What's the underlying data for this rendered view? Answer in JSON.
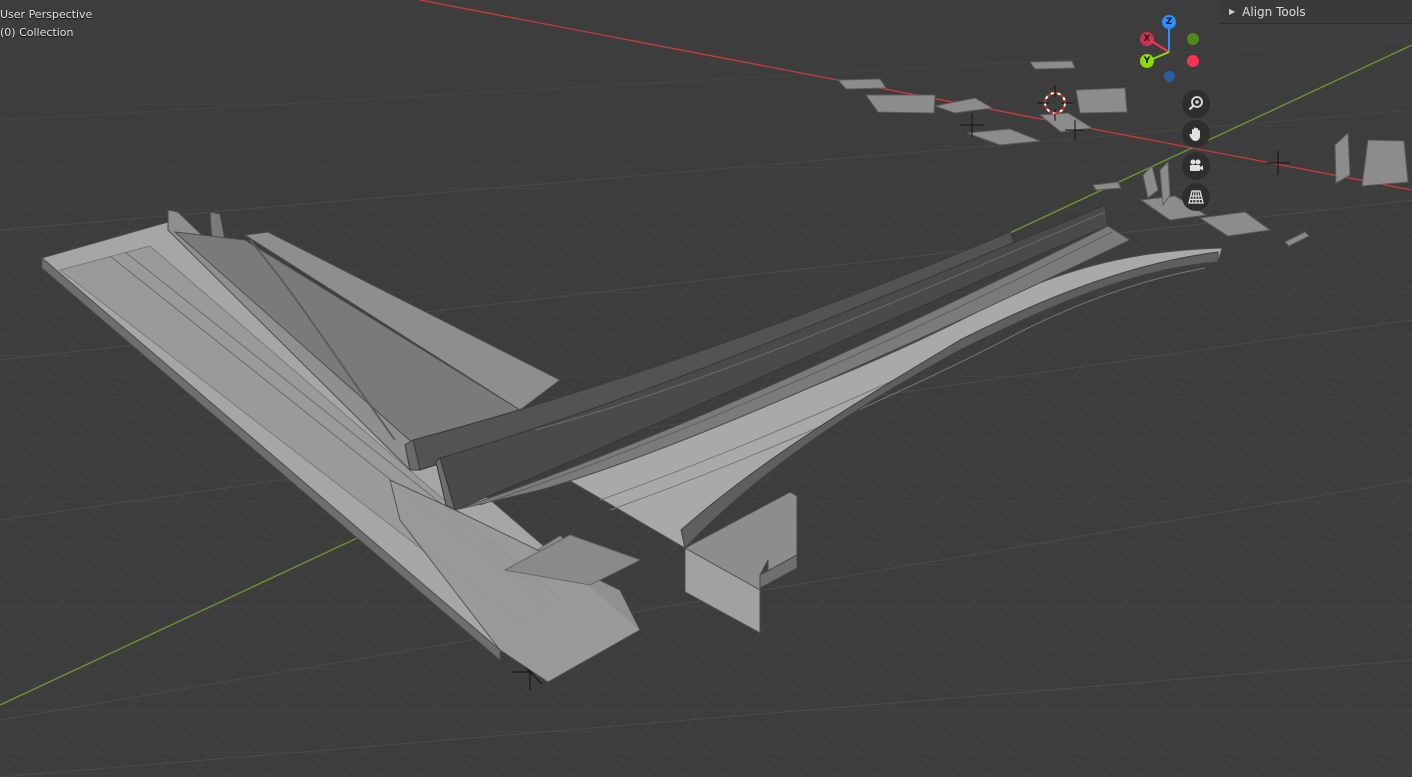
{
  "viewport": {
    "view_name": "User Perspective",
    "collection": "(0) Collection"
  },
  "sidebar_panel": {
    "align_tools_label": "Align Tools"
  },
  "navigation_gizmo": {
    "axis_labels": {
      "x": "X",
      "y": "Y",
      "z": "Z"
    },
    "axis_colors": {
      "x": "#ff3352",
      "y": "#8bdc00",
      "z": "#2890ff"
    },
    "buttons": [
      {
        "name": "zoom",
        "icon": "zoom-icon"
      },
      {
        "name": "pan",
        "icon": "hand-icon"
      },
      {
        "name": "camera",
        "icon": "camera-icon"
      },
      {
        "name": "orthographic",
        "icon": "grid-icon"
      }
    ]
  },
  "colors": {
    "background": "#3d3d3d",
    "grid_line": "#4a4a4a",
    "x_axis": "#c83c3c",
    "y_axis": "#6f9a2b",
    "mesh_light": "#a3a3a3",
    "mesh_mid": "#8a8a8a",
    "mesh_dark": "#5a5a5a"
  }
}
